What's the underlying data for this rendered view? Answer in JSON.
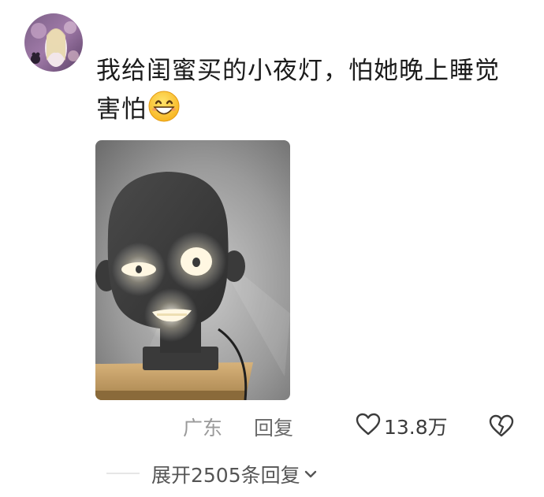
{
  "comment": {
    "text": "我给闺蜜买的小夜灯，怕她晚上睡觉害怕",
    "emoji": "grinning-face-emoji"
  },
  "photo": {
    "subject": "face-shaped-night-lamp"
  },
  "meta": {
    "location": "广东",
    "reply_label": "回复",
    "like_count": "13.8万"
  },
  "replies": {
    "expand_label": "展开2505条回复"
  },
  "icons": {
    "like": "heart-outline-icon",
    "dislike": "broken-heart-icon",
    "expand": "chevron-down-icon"
  },
  "colors": {
    "text": "#1b1b1b",
    "muted": "#9a9a9a",
    "secondary": "#555555",
    "background": "#ffffff"
  }
}
